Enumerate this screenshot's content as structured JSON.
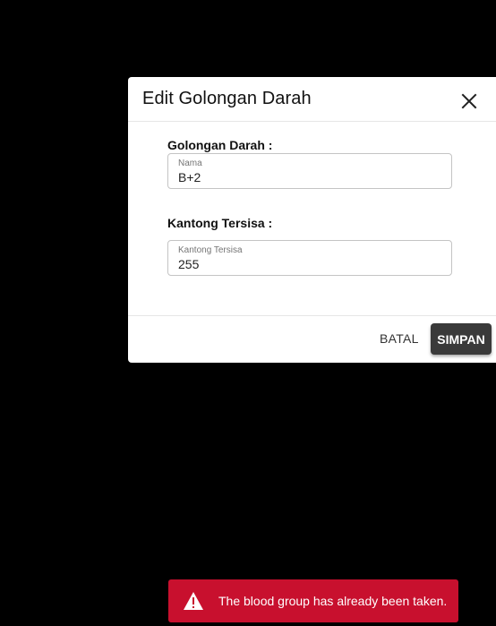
{
  "dialog": {
    "title": "Edit Golongan Darah",
    "close_icon": "close-icon",
    "fields": [
      {
        "section_label": "Golongan Darah :",
        "float_label": "Nama",
        "value": "B+2"
      },
      {
        "section_label": "Kantong Tersisa :",
        "float_label": "Kantong Tersisa",
        "value": "255"
      }
    ],
    "cancel_label": "BATAL",
    "save_label": "SIMPAN"
  },
  "toast": {
    "icon": "warning-icon",
    "message": "The blood group has already been taken.",
    "color": "#c8102e"
  },
  "colors": {
    "overlay": "#000000",
    "save_button": "#3a3a3a"
  }
}
